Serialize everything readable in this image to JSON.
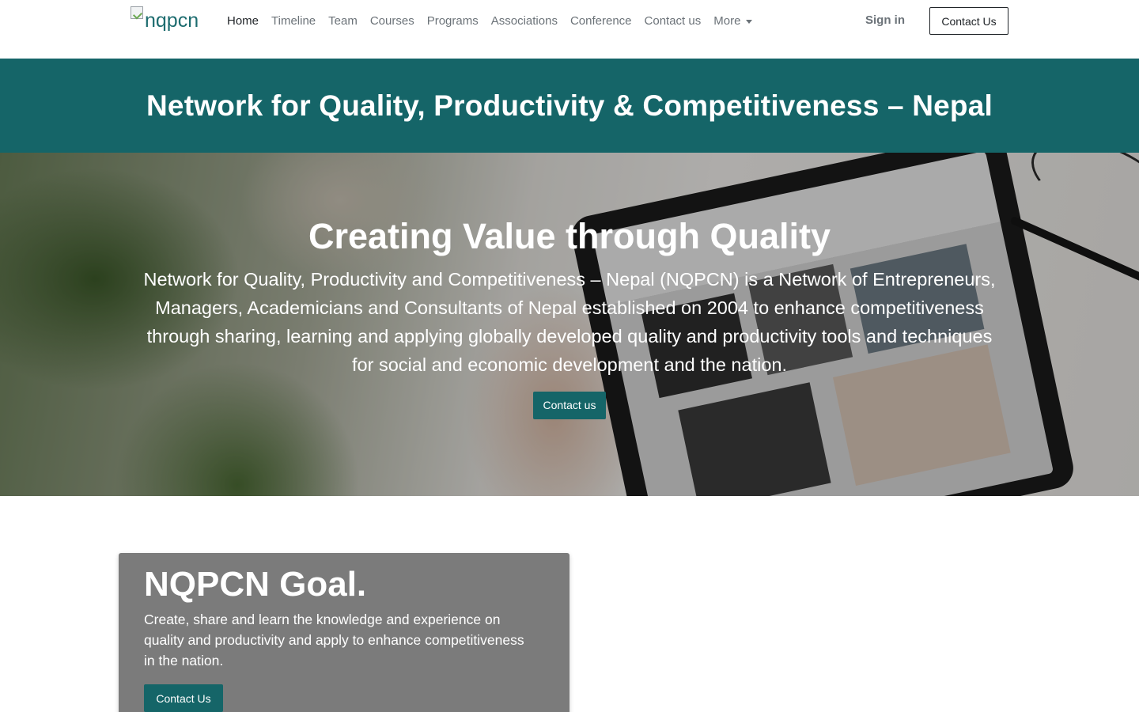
{
  "navbar": {
    "logo_alt": "nqpcn",
    "links": [
      {
        "label": "Home"
      },
      {
        "label": "Timeline"
      },
      {
        "label": "Team"
      },
      {
        "label": "Courses"
      },
      {
        "label": "Programs"
      },
      {
        "label": "Associations"
      },
      {
        "label": "Conference"
      },
      {
        "label": "Contact us"
      },
      {
        "label": "More"
      }
    ],
    "signin_label": "Sign in",
    "cta_label": "Contact Us"
  },
  "banner": {
    "title": "Network for Quality, Productivity & Competitiveness – Nepal"
  },
  "hero": {
    "heading": "Creating Value through Quality",
    "description": "Network for Quality, Productivity and Competitiveness – Nepal (NQPCN) is a Network of Entrepreneurs, Managers, Academicians and Consultants of Nepal established on 2004 to enhance competitiveness through sharing, learning and applying globally developed quality and productivity tools and techniques for social and economic development and the nation.",
    "button_label": "Contact us"
  },
  "goal": {
    "heading": "NQPCN Goal.",
    "text": "Create, share and learn the knowledge and experience on quality and productivity and apply to enhance competitiveness in the nation.",
    "button_label": "Contact Us"
  },
  "colors": {
    "primary": "#156568",
    "card_bg": "#7b7b7b"
  }
}
